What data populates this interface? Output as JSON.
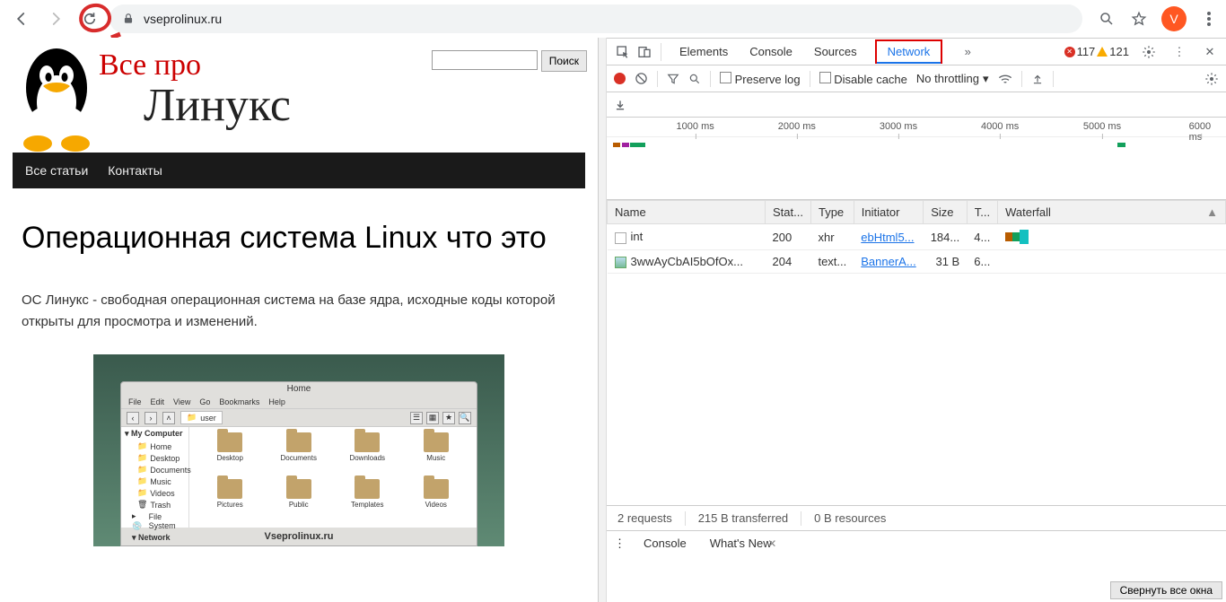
{
  "browser": {
    "url": "vseprolinux.ru",
    "avatar_letter": "V"
  },
  "site": {
    "red_title": "Все про",
    "big_title": "Линукс",
    "search_button": "Поиск",
    "nav": {
      "all_articles": "Все статьи",
      "contacts": "Контакты"
    }
  },
  "article": {
    "title": "Операционная система Linux что это",
    "paragraph": "ОС Линукс - свободная операционная система на базе ядра, исходные коды которой открыты для просмотра и изменений."
  },
  "fm": {
    "window_title": "Home",
    "menu": {
      "file": "File",
      "edit": "Edit",
      "view": "View",
      "go": "Go",
      "bookmarks": "Bookmarks",
      "help": "Help"
    },
    "crumb": "user",
    "side_head": "My Computer",
    "side": {
      "home": "Home",
      "desktop": "Desktop",
      "documents": "Documents",
      "music": "Music",
      "videos": "Videos",
      "trash": "Trash",
      "filesystem": "File System",
      "network": "Network"
    },
    "folders": {
      "desktop": "Desktop",
      "documents": "Documents",
      "downloads": "Downloads",
      "music": "Music",
      "pictures": "Pictures",
      "public": "Public",
      "templates": "Templates",
      "videos": "Videos"
    },
    "footer": "Vseprolinux.ru"
  },
  "devtools": {
    "tabs": {
      "elements": "Elements",
      "console": "Console",
      "sources": "Sources",
      "network": "Network"
    },
    "errors_count": "117",
    "warnings_count": "121",
    "preserve_log": "Preserve log",
    "disable_cache": "Disable cache",
    "throttling": "No throttling",
    "timeline_ticks": [
      "1000 ms",
      "2000 ms",
      "3000 ms",
      "4000 ms",
      "5000 ms",
      "6000 ms"
    ],
    "columns": {
      "name": "Name",
      "status": "Stat...",
      "type": "Type",
      "initiator": "Initiator",
      "size": "Size",
      "time": "T...",
      "waterfall": "Waterfall"
    },
    "rows": [
      {
        "name": "int",
        "status": "200",
        "type": "xhr",
        "initiator": "ebHtml5...",
        "size": "184...",
        "time": "4..."
      },
      {
        "name": "3wwAyCbAI5bOfOx...",
        "status": "204",
        "type": "text...",
        "initiator": "BannerA...",
        "size": "31 B",
        "time": "6..."
      }
    ],
    "status_bar": {
      "requests": "2 requests",
      "transferred": "215 B transferred",
      "resources": "0 B resources"
    },
    "drawer": {
      "console": "Console",
      "whatsnew": "What's New"
    }
  },
  "minimize_all": "Свернуть все окна"
}
